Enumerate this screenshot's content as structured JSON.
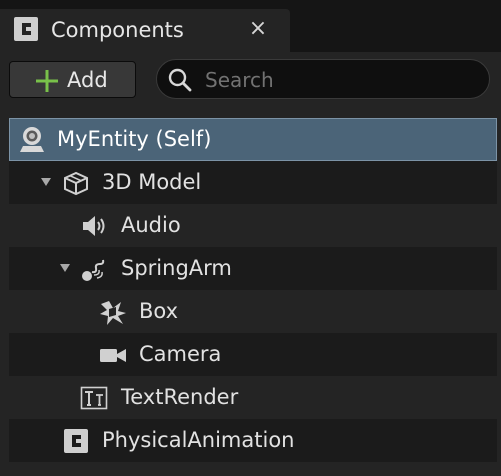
{
  "tab": {
    "title": "Components",
    "close_glyph": "×"
  },
  "toolbar": {
    "add_label": "Add",
    "add_icon": "plus-icon",
    "search_placeholder": "Search",
    "search_value": "",
    "accent": "#79c14a"
  },
  "tree": {
    "selected_color": "#4b6478",
    "items": [
      {
        "label": "MyEntity (Self)",
        "icon": "entity-icon",
        "depth": 0,
        "expanded": null,
        "selected": true
      },
      {
        "label": "3D Model",
        "icon": "box-model-icon",
        "depth": 1,
        "expanded": true,
        "selected": false
      },
      {
        "label": "Audio",
        "icon": "speaker-icon",
        "depth": 2,
        "expanded": null,
        "selected": false
      },
      {
        "label": "SpringArm",
        "icon": "spring-arm-icon",
        "depth": 2,
        "expanded": true,
        "selected": false
      },
      {
        "label": "Box",
        "icon": "box-collision-icon",
        "depth": 3,
        "expanded": null,
        "selected": false
      },
      {
        "label": "Camera",
        "icon": "camera-icon",
        "depth": 3,
        "expanded": null,
        "selected": false
      },
      {
        "label": "TextRender",
        "icon": "text-render-icon",
        "depth": 2,
        "expanded": null,
        "selected": false
      },
      {
        "label": "PhysicalAnimation",
        "icon": "component-icon",
        "depth": 1,
        "expanded": null,
        "selected": false
      }
    ]
  }
}
